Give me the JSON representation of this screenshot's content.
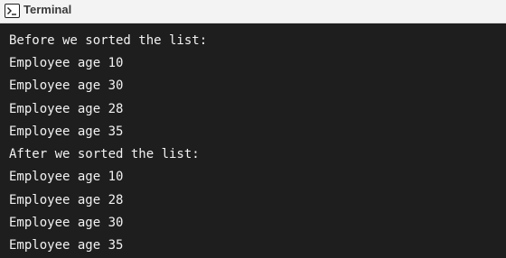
{
  "window": {
    "title": "Terminal",
    "icon": "terminal-icon"
  },
  "console": {
    "lines": [
      "Before we sorted the list:",
      "Employee age 10",
      "Employee age 30",
      "Employee age 28",
      "Employee age 35",
      "After we sorted the list:",
      "Employee age 10",
      "Employee age 28",
      "Employee age 30",
      "Employee age 35"
    ]
  },
  "colors": {
    "background": "#1e1e1e",
    "text": "#f2f2f2",
    "titlebar": "#f3f3f3"
  }
}
